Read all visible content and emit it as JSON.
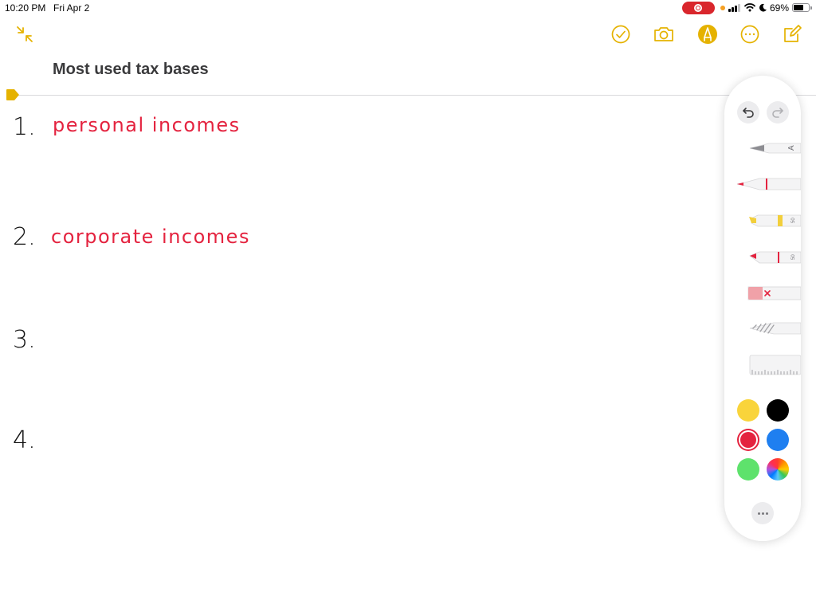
{
  "status_bar": {
    "time": "10:20 PM",
    "date": "Fri Apr 2",
    "battery_percent": "69%",
    "battery_level": 0.69,
    "icons": [
      "screen-recording-icon",
      "mic-indicator-icon",
      "cellular-signal-icon",
      "wifi-icon",
      "do-not-disturb-icon",
      "battery-icon"
    ]
  },
  "toolbar": {
    "left_icon": "collapse-arrows-icon",
    "right_icons": [
      "checklist-icon",
      "camera-icon",
      "markup-pen-icon",
      "more-options-icon",
      "new-note-icon"
    ],
    "accent_color": "#e5b200"
  },
  "note": {
    "title": "Most used tax bases",
    "items": [
      {
        "number": "1.",
        "text": "personal incomes"
      },
      {
        "number": "2.",
        "text": "corporate incomes"
      },
      {
        "number": "3.",
        "text": ""
      },
      {
        "number": "4.",
        "text": ""
      }
    ],
    "ink_color": "#e4233f",
    "number_color": "#111111"
  },
  "palette": {
    "undo_icon": "undo-icon",
    "redo_icon": "redo-icon",
    "tools": [
      "monoline-pen-tool",
      "pen-tool",
      "highlighter-tool",
      "pencil-tool",
      "eraser-tool",
      "lasso-tool",
      "ruler-tool"
    ],
    "tool_marks": {
      "monoline": "A",
      "highlighter": "50",
      "pencil": "50"
    },
    "colors": [
      {
        "name": "yellow",
        "hex": "#f9d43b",
        "selected": false
      },
      {
        "name": "black",
        "hex": "#000000",
        "selected": false
      },
      {
        "name": "red",
        "hex": "#e4233f",
        "selected": true
      },
      {
        "name": "blue",
        "hex": "#1f7ff0",
        "selected": false
      },
      {
        "name": "green",
        "hex": "#5ee26c",
        "selected": false
      },
      {
        "name": "custom",
        "hex": "multicolor",
        "selected": false
      }
    ],
    "more_icon": "ellipsis-icon"
  }
}
